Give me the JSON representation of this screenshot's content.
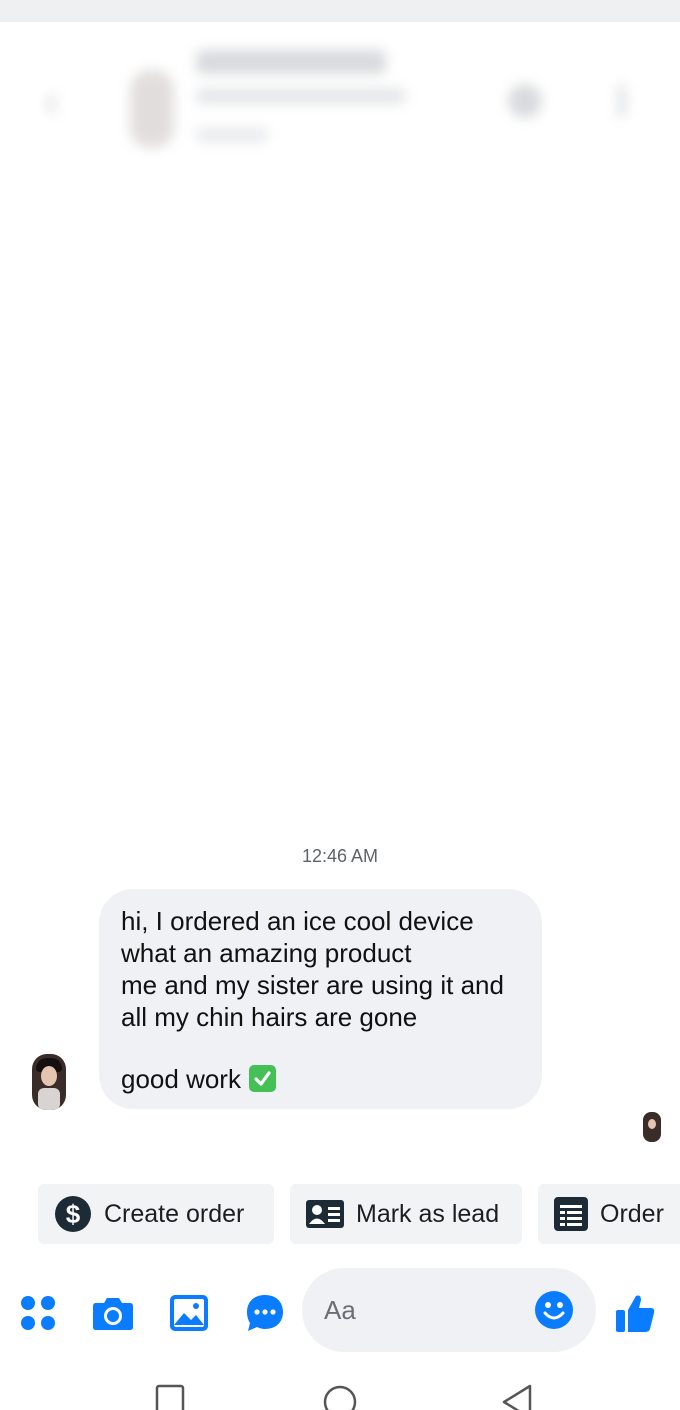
{
  "colors": {
    "accent": "#0a7cff",
    "bubble_bg": "#eff1f4",
    "chip_bg": "#f2f3f5",
    "check_green": "#44c057"
  },
  "header": {
    "back_icon": "chevron-left-icon",
    "call_icon": "phone-icon",
    "more_icon": "more-vertical-icon"
  },
  "conversation": {
    "timestamp": "12:46 AM",
    "message": {
      "lines": [
        "hi, I ordered an ice cool device",
        "what an amazing product",
        "me and my sister are using it and",
        "all my chin hairs are gone"
      ],
      "closing": "good work",
      "closing_emoji": "check-mark-button-icon"
    }
  },
  "actions": [
    {
      "label": "Create order",
      "icon": "dollar-circle-icon"
    },
    {
      "label": "Mark as lead",
      "icon": "contact-card-icon"
    },
    {
      "label": "Order",
      "icon": "list-sheet-icon"
    }
  ],
  "composer": {
    "placeholder": "Aa",
    "icons": [
      "apps-grid-icon",
      "camera-icon",
      "image-icon",
      "chat-bubble-icon",
      "emoji-icon",
      "thumbs-up-icon"
    ]
  },
  "system_nav": [
    "recent-apps-icon",
    "home-icon",
    "back-triangle-icon"
  ]
}
